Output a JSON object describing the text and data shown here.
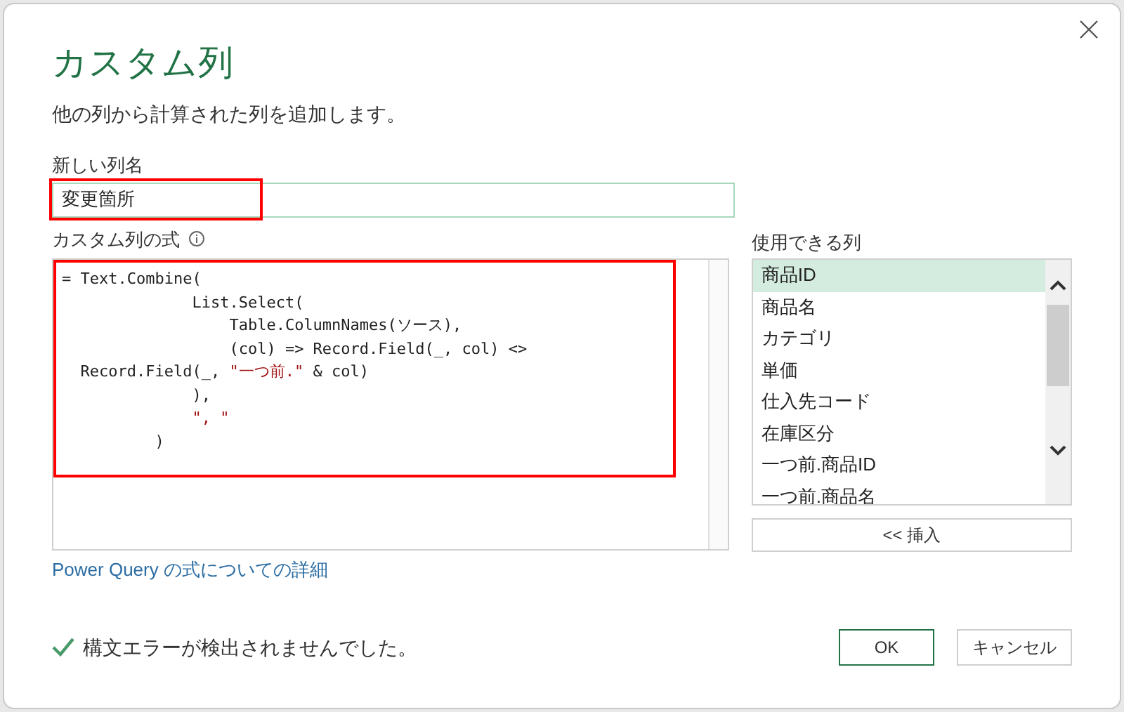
{
  "dialog": {
    "title": "カスタム列",
    "subtitle": "他の列から計算された列を追加します。"
  },
  "column_name": {
    "label": "新しい列名",
    "value": "変更箇所"
  },
  "formula": {
    "label": "カスタム列の式",
    "lines": [
      [
        {
          "kind": "plain",
          "text": "= Text.Combine("
        }
      ],
      [
        {
          "kind": "plain",
          "text": "              List.Select("
        }
      ],
      [
        {
          "kind": "plain",
          "text": "                  Table.ColumnNames(ソース),"
        }
      ],
      [
        {
          "kind": "plain",
          "text": "                  (col) => Record.Field(_, col) <>"
        }
      ],
      [
        {
          "kind": "plain",
          "text": "  Record.Field(_, "
        },
        {
          "kind": "string",
          "text": "\"一つ前.\""
        },
        {
          "kind": "plain",
          "text": " & col)"
        }
      ],
      [
        {
          "kind": "plain",
          "text": "              ),"
        }
      ],
      [
        {
          "kind": "string",
          "text": "              \", \""
        }
      ],
      [
        {
          "kind": "plain",
          "text": "          )"
        }
      ]
    ]
  },
  "available_columns": {
    "label": "使用できる列",
    "items": [
      {
        "label": "商品ID",
        "selected": true
      },
      {
        "label": "商品名",
        "selected": false
      },
      {
        "label": "カテゴリ",
        "selected": false
      },
      {
        "label": "単価",
        "selected": false
      },
      {
        "label": "仕入先コード",
        "selected": false
      },
      {
        "label": "在庫区分",
        "selected": false
      },
      {
        "label": "一つ前.商品ID",
        "selected": false
      },
      {
        "label": "一つ前.商品名",
        "selected": false
      }
    ],
    "insert_button": "<< 挿入"
  },
  "help_link": "Power Query の式についての詳細",
  "status": "構文エラーが検出されませんでした。",
  "buttons": [
    "OK",
    "キャンセル"
  ]
}
